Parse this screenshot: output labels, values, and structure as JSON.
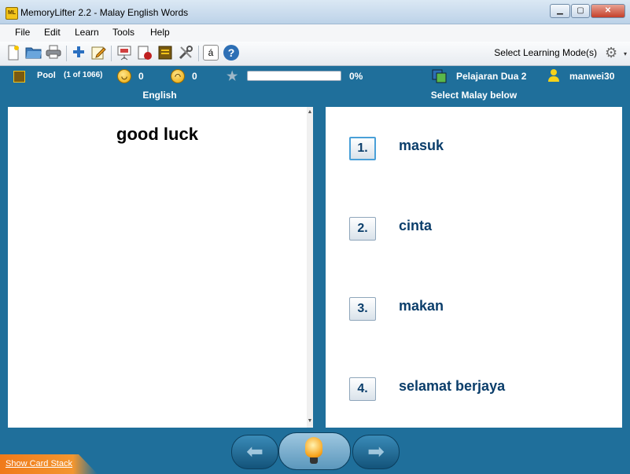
{
  "window": {
    "app_icon_text": "ML",
    "title": "MemoryLifter 2.2 - Malay English Words",
    "controls": {
      "minimize": "▁",
      "maximize": "▢",
      "close": "✕"
    }
  },
  "menu": {
    "items": [
      "File",
      "Edit",
      "Learn",
      "Tools",
      "Help"
    ]
  },
  "toolbar": {
    "icons": [
      "new-document-icon",
      "open-folder-icon",
      "print-icon",
      "add-card-icon",
      "edit-icon",
      "slideshow-icon",
      "statistics-icon",
      "dictionary-icon",
      "settings-tools-icon",
      "special-character-icon",
      "help-icon"
    ],
    "special_char_glyph": "á",
    "help_glyph": "?",
    "learning_mode_label": "Select Learning Mode(s)",
    "gear_glyph": "⚙",
    "caret_glyph": "▾"
  },
  "status": {
    "pool_label": "Pool",
    "pool_count": "(1 of 1066)",
    "correct_count": "0",
    "wrong_count": "0",
    "progress_percent": "0%",
    "progress_fraction": 0,
    "chapter_name": "Pelajaran Dua 2",
    "user_name": "manwei30",
    "colors": {
      "status_bg": "#1f6f9b",
      "answer_text": "#0b3e6b"
    }
  },
  "panels": {
    "left_header": "English",
    "right_header": "Select Malay below"
  },
  "card": {
    "question": "good luck"
  },
  "answers": [
    {
      "number": "1.",
      "text": "masuk"
    },
    {
      "number": "2.",
      "text": "cinta"
    },
    {
      "number": "3.",
      "text": "makan"
    },
    {
      "number": "4.",
      "text": "selamat berjaya"
    }
  ],
  "bottom": {
    "show_card_stack": "Show Card Stack",
    "back_arrow": "⬅",
    "next_arrow": "➡"
  }
}
